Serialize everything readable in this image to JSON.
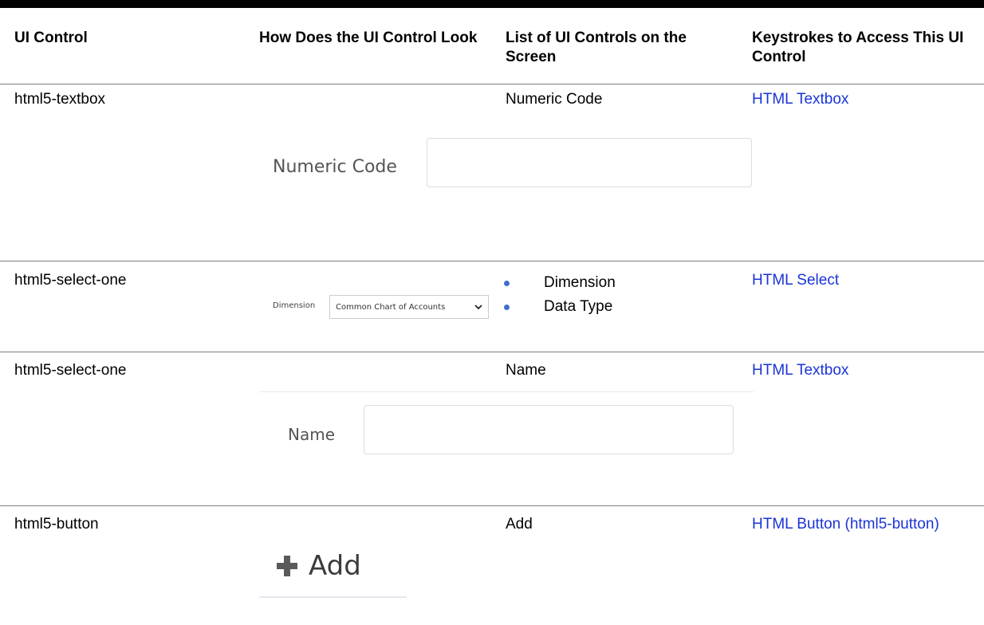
{
  "table": {
    "headers": [
      "UI Control",
      "How Does the UI Control Look",
      "List of UI Controls on the Screen",
      "Keystrokes to Access This UI Control"
    ],
    "rows": [
      {
        "control": "html5-textbox",
        "screen_controls": [
          "Numeric Code"
        ],
        "keystroke_link": "HTML Textbox",
        "mockup": {
          "label": "Numeric Code",
          "type": "textbox",
          "value": ""
        }
      },
      {
        "control": "html5-select-one",
        "screen_controls": [
          "Dimension",
          "Data Type"
        ],
        "keystroke_link": "HTML Select",
        "mockup": {
          "label": "Dimension",
          "type": "select",
          "selected": "Common Chart of Accounts"
        }
      },
      {
        "control": "html5-select-one",
        "screen_controls": [
          "Name"
        ],
        "keystroke_link": "HTML Textbox",
        "mockup": {
          "label": "Name",
          "type": "textbox",
          "value": ""
        }
      },
      {
        "control": "html5-button",
        "screen_controls": [
          "Add"
        ],
        "keystroke_link": "HTML Button (html5-button)",
        "mockup": {
          "label": "Add",
          "type": "button",
          "icon": "plus-icon"
        }
      }
    ]
  },
  "colors": {
    "link": "#1a34d6",
    "bullet": "#3f6fcc",
    "rule": "#000000"
  }
}
